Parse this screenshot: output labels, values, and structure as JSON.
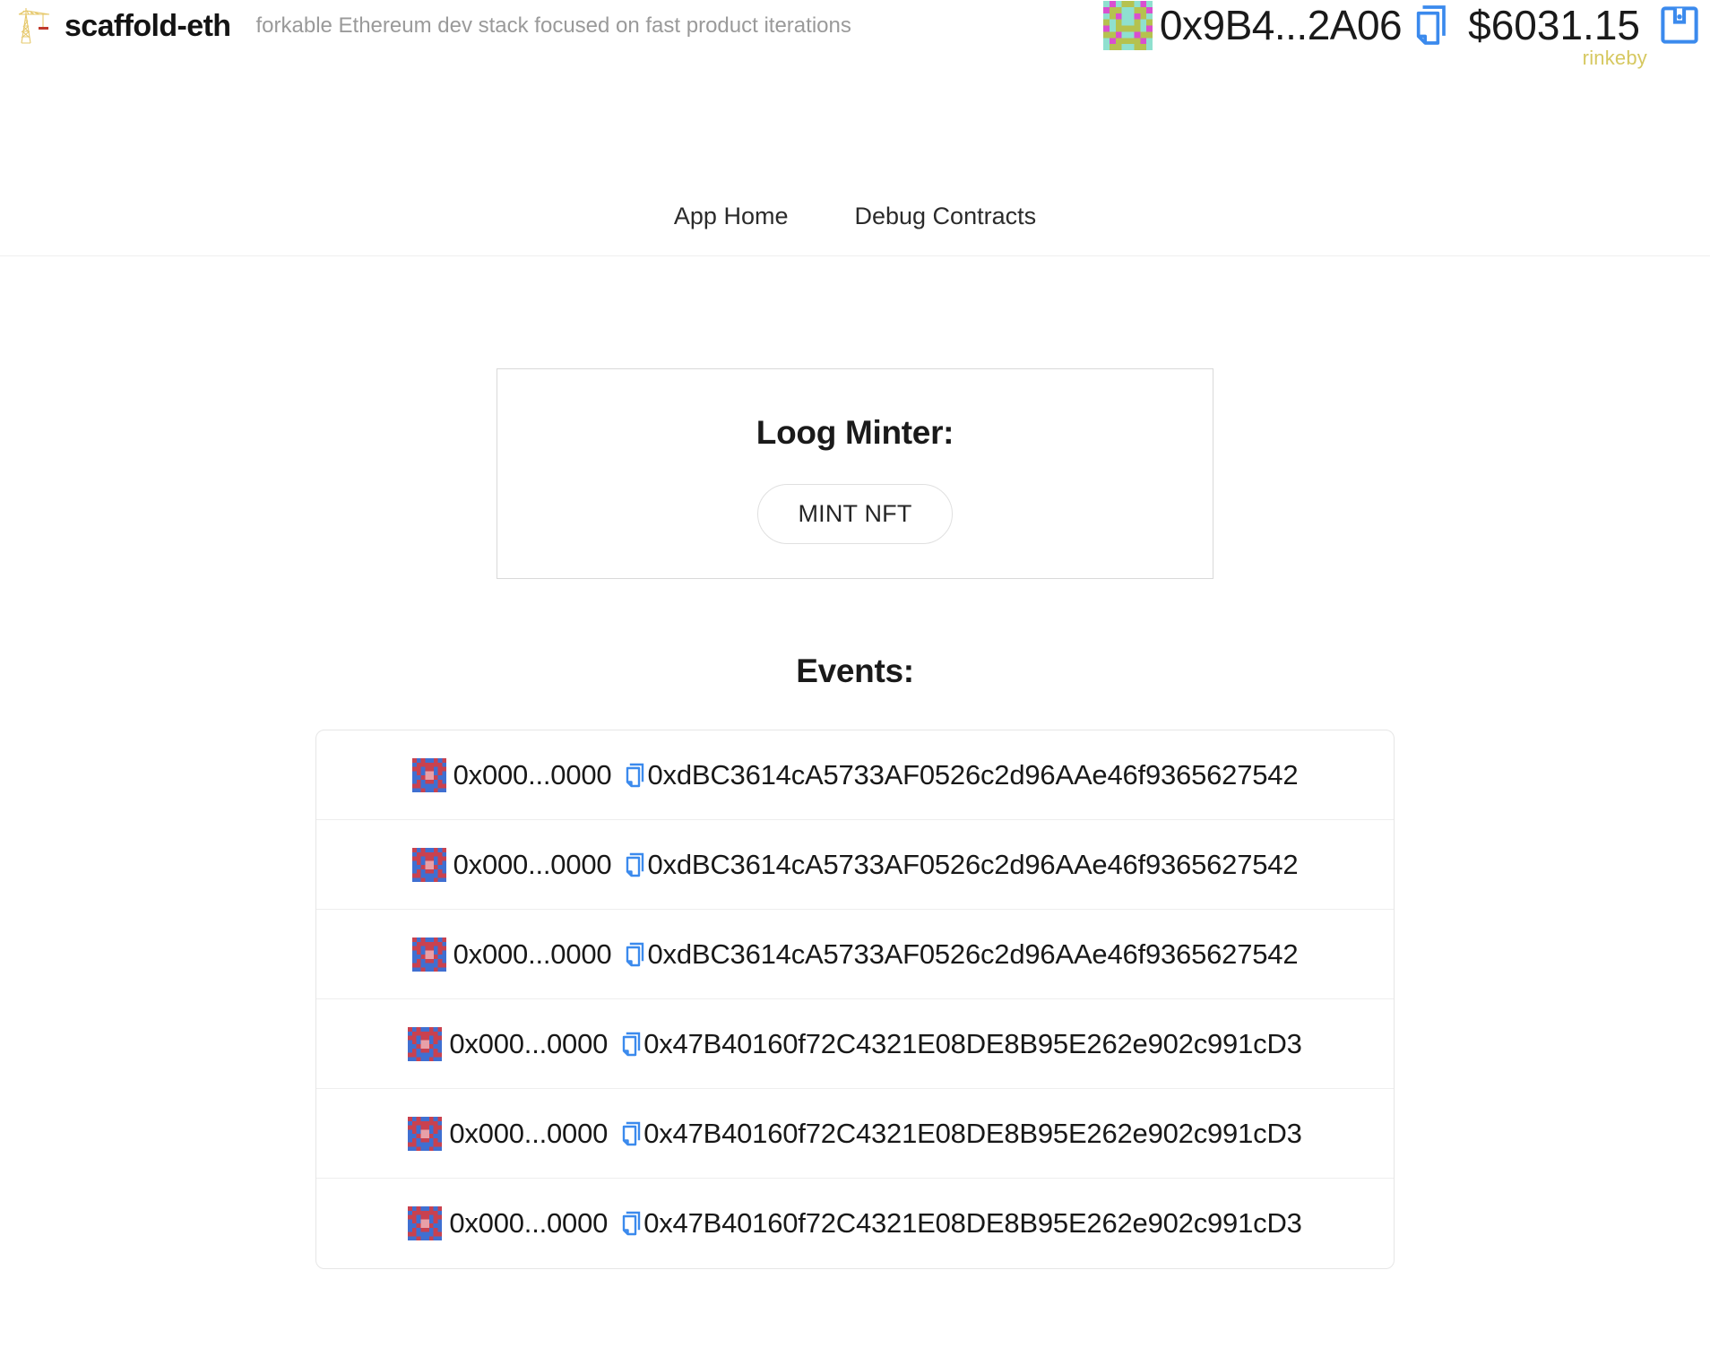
{
  "header": {
    "logo_icon": "construction-crane-icon",
    "brand": "scaffold-eth",
    "tagline": "forkable Ethereum dev stack focused on fast product iterations",
    "account": {
      "avatar_icon": "blockie-avatar",
      "address": "0x9B4...2A06",
      "copy_icon": "copy-icon",
      "balance": "$6031.15",
      "wallet_icon": "wallet-save-icon",
      "network": "rinkeby",
      "network_color": "#d6c860"
    }
  },
  "nav": {
    "links": [
      {
        "label": "App Home"
      },
      {
        "label": "Debug Contracts"
      }
    ]
  },
  "minter": {
    "title": "Loog Minter:",
    "mint_button": "MINT NFT"
  },
  "events": {
    "title": "Events:",
    "rows": [
      {
        "from": "0x000...0000",
        "to": "0xdBC3614cA5733AF0526c2d96AAe46f9365627542",
        "copy_icon": "copy-icon"
      },
      {
        "from": "0x000...0000",
        "to": "0xdBC3614cA5733AF0526c2d96AAe46f9365627542",
        "copy_icon": "copy-icon"
      },
      {
        "from": "0x000...0000",
        "to": "0xdBC3614cA5733AF0526c2d96AAe46f9365627542",
        "copy_icon": "copy-icon"
      },
      {
        "from": "0x000...0000",
        "to": "0x47B40160f72C4321E08DE8B95E262e902c991cD3",
        "copy_icon": "copy-icon"
      },
      {
        "from": "0x000...0000",
        "to": "0x47B40160f72C4321E08DE8B95E262e902c991cD3",
        "copy_icon": "copy-icon"
      },
      {
        "from": "0x000...0000",
        "to": "0x47B40160f72C4321E08DE8B95E262e902c991cD3",
        "copy_icon": "copy-icon"
      }
    ]
  },
  "colors": {
    "accent_blue": "#3b8aed",
    "text": "#1a1a1a",
    "muted": "#9a9a9a",
    "border": "#e6e6e6"
  }
}
